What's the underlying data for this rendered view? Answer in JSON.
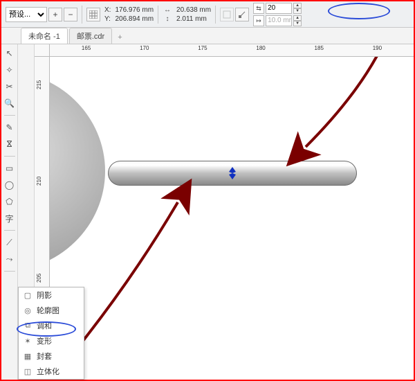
{
  "toolbar": {
    "preset_label": "预设...",
    "add_label": "+",
    "remove_label": "−",
    "x_label": "X:",
    "y_label": "Y:",
    "x_value": "176.976 mm",
    "y_value": "206.894 mm",
    "w_value": "20.638 mm",
    "h_value": "2.011 mm",
    "steps_value": "20",
    "offset_value": "10.0 mm"
  },
  "tabs": {
    "t1": "未命名 -1",
    "t2": "邮票.cdr",
    "plus": "+"
  },
  "ruler": {
    "h": [
      "165",
      "170",
      "175",
      "180",
      "185",
      "190"
    ],
    "v": [
      "215",
      "210",
      "205"
    ]
  },
  "flyout": {
    "items": [
      {
        "label": "阴影"
      },
      {
        "label": "轮廓图"
      },
      {
        "label": "调和"
      },
      {
        "label": "变形"
      },
      {
        "label": "封套"
      },
      {
        "label": "立体化"
      }
    ]
  }
}
